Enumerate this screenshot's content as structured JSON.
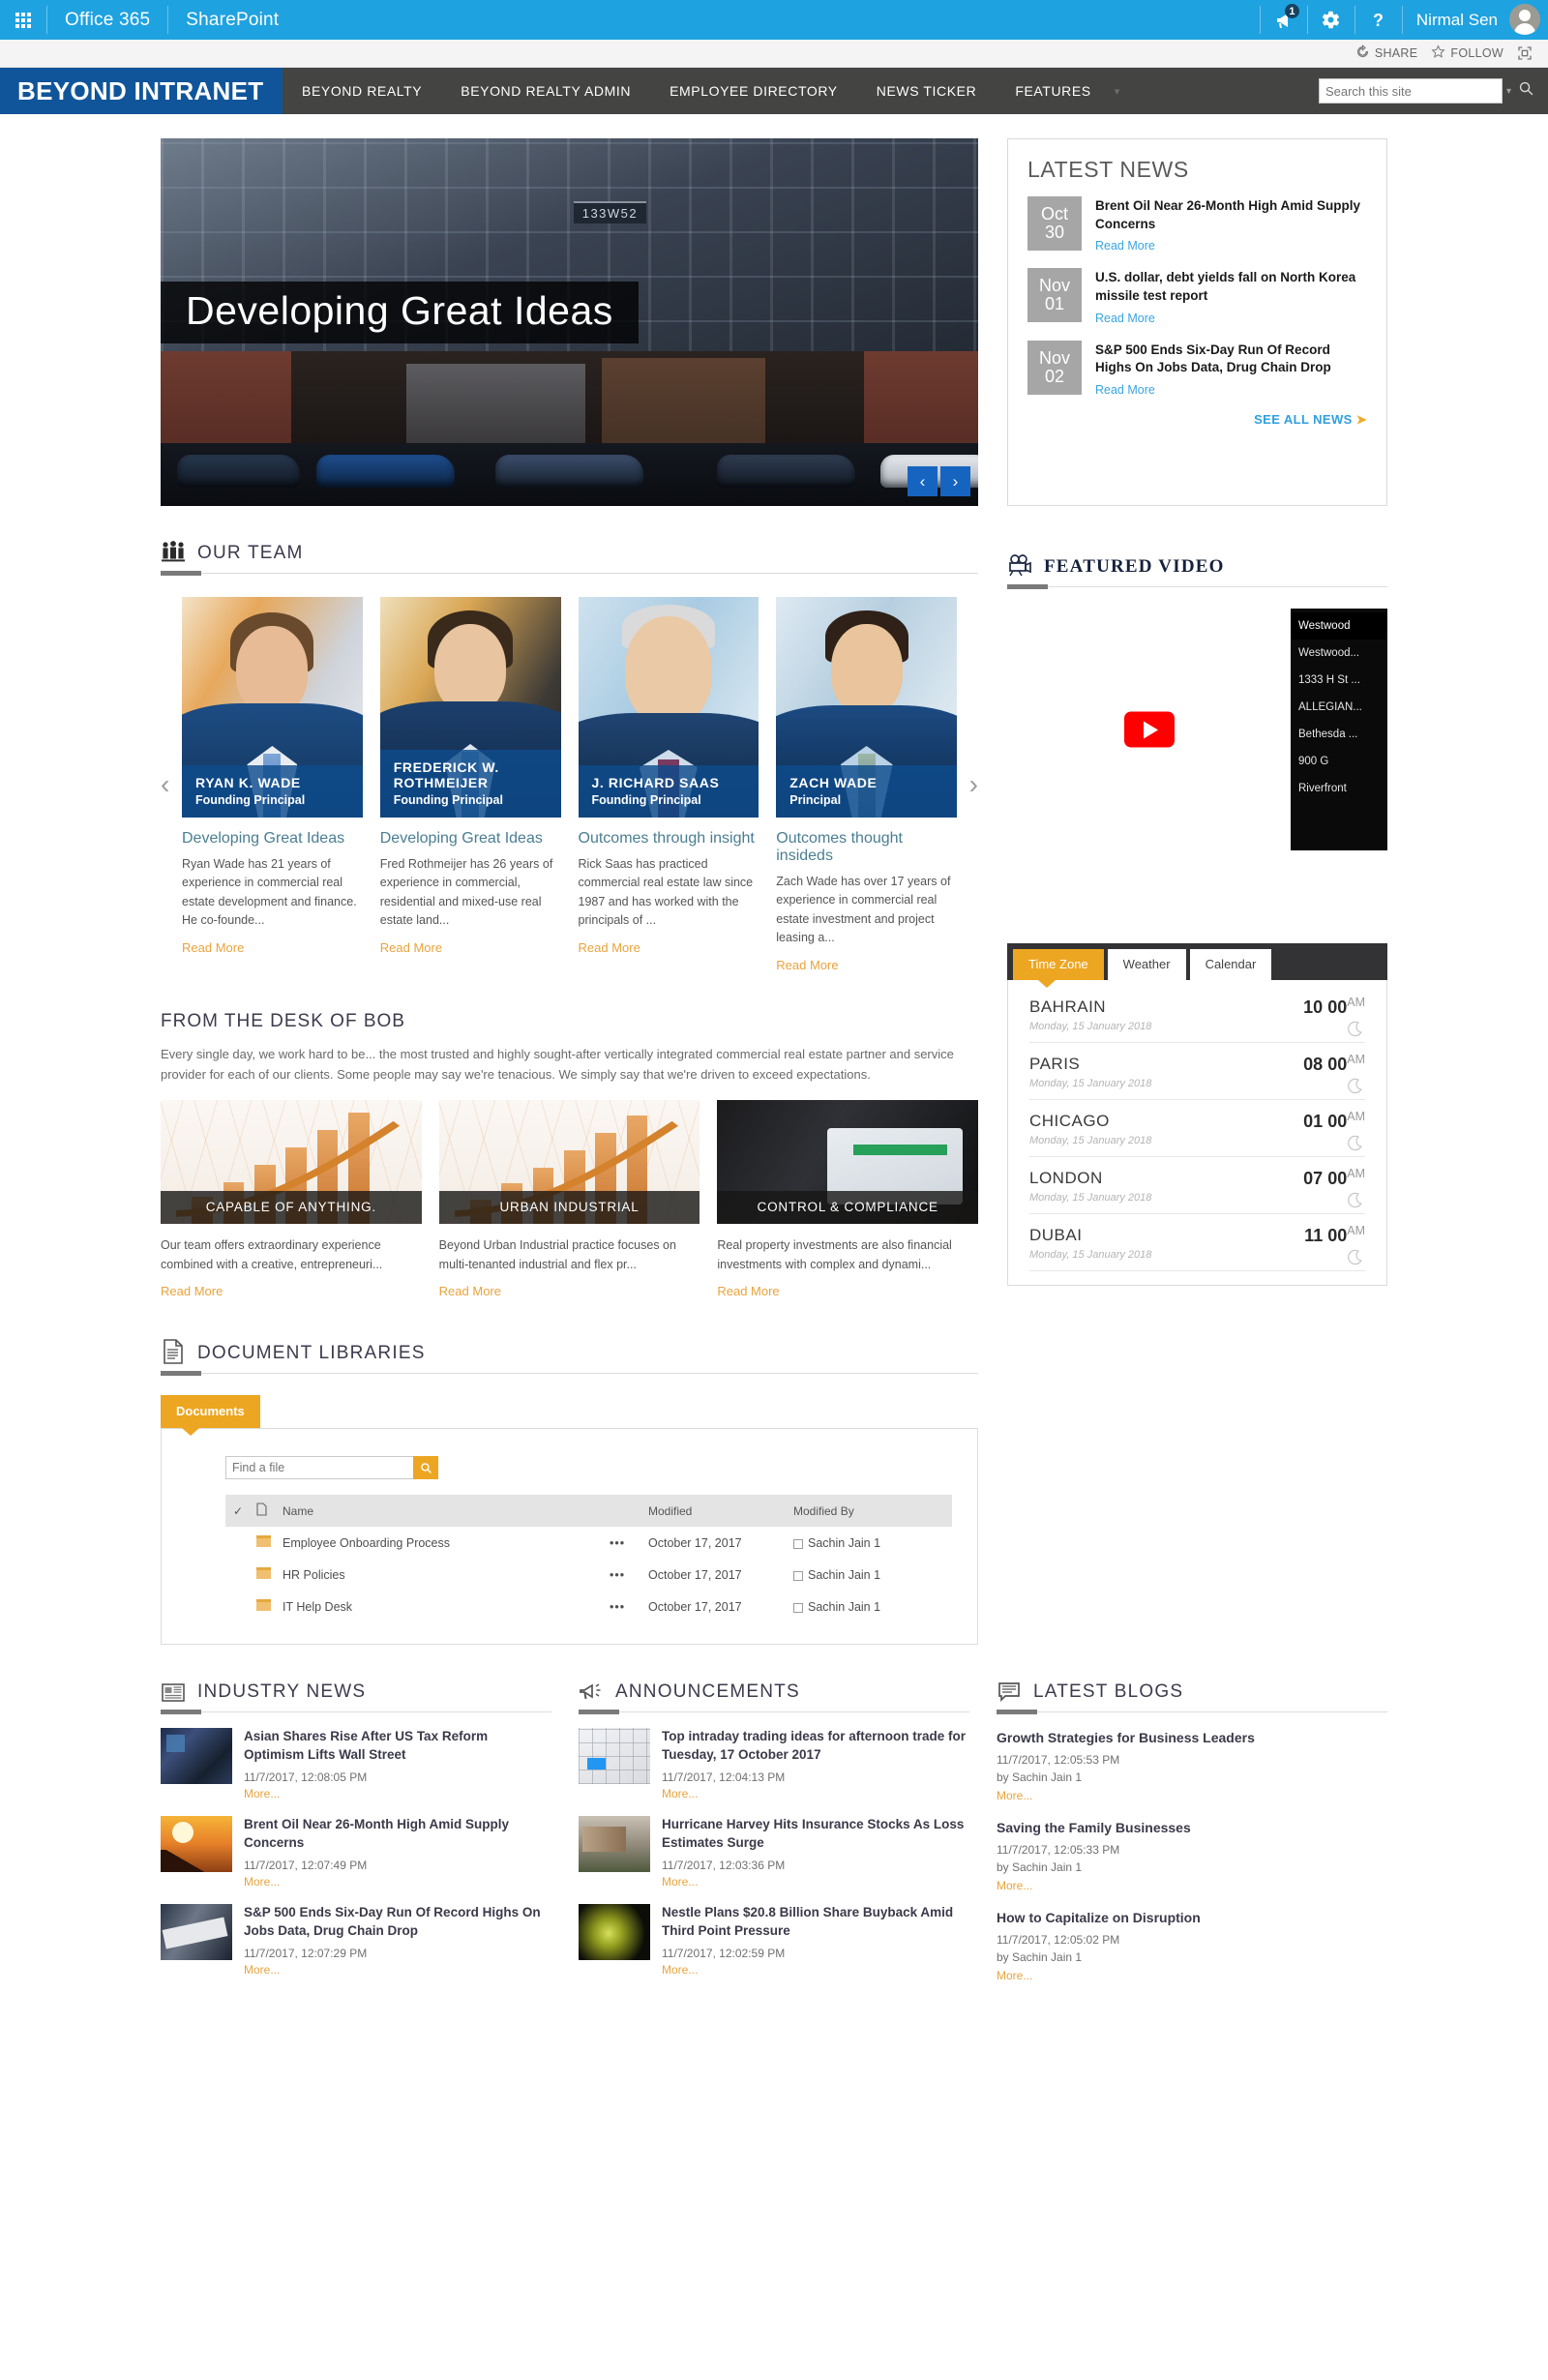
{
  "suite": {
    "waffle_icon": "app-launcher-icon",
    "office_label": "Office 365",
    "app_label": "SharePoint",
    "notification_icon": "megaphone-icon",
    "notification_count": "1",
    "settings_icon": "gear-icon",
    "help_icon": "question-mark-icon",
    "user_name": "Nirmal Sen",
    "avatar_icon": "user-avatar-icon",
    "accent_color": "#1fa2e0"
  },
  "share_row": {
    "share_icon": "share-icon",
    "share_label": "SHARE",
    "follow_icon": "star-icon",
    "follow_label": "FOLLOW",
    "focus_icon": "focus-on-content-icon"
  },
  "topnav": {
    "brand": "BEYOND INTRANET",
    "brand_color": "#10559a",
    "bar_color": "#444442",
    "links": [
      {
        "label": "BEYOND  REALTY"
      },
      {
        "label": "BEYOND  REALTY ADMIN"
      },
      {
        "label": "EMPLOYEE DIRECTORY"
      },
      {
        "label": "NEWS TICKER"
      },
      {
        "label": "FEATURES"
      }
    ],
    "caret_icon": "chevron-down-icon",
    "search_placeholder": "Search this site",
    "search_value": "",
    "search_caret_icon": "chevron-down-icon",
    "search_icon": "search-magnifier-icon"
  },
  "hero": {
    "caption": "Developing Great Ideas",
    "building_sign": "133W52",
    "prev_icon": "chevron-left-icon",
    "next_icon": "chevron-right-icon",
    "prev_label": "‹",
    "next_label": "›"
  },
  "latest_news": {
    "title": "LATEST NEWS",
    "items": [
      {
        "month": "Oct",
        "day": "30",
        "headline": "Brent Oil Near 26-Month High Amid Supply Concerns",
        "link": "Read More"
      },
      {
        "month": "Nov",
        "day": "01",
        "headline": "U.S. dollar, debt yields fall on North Korea missile test report",
        "link": "Read More"
      },
      {
        "month": "Nov",
        "day": "02",
        "headline": "S&P 500 Ends Six-Day Run Of Record Highs On Jobs Data, Drug Chain Drop",
        "link": "Read More"
      }
    ],
    "see_all": "SEE ALL NEWS",
    "see_all_arrow": "➤"
  },
  "our_team": {
    "icon": "people-group-icon",
    "title": "OUR TEAM",
    "prev_icon": "chevron-left-icon",
    "next_icon": "chevron-right-icon",
    "prev_label": "‹",
    "next_label": "›",
    "members": [
      {
        "name": "RYAN K. WADE",
        "role": "Founding Principal",
        "heading": "Developing Great Ideas",
        "excerpt": "Ryan Wade has 21 years of experience in commercial real estate development and finance. He co-founde...",
        "link": "Read More"
      },
      {
        "name": "FREDERICK W. ROTHMEIJER",
        "role": "Founding Principal",
        "heading": "Developing Great Ideas",
        "excerpt": "Fred Rothmeijer has 26 years of experience in commercial, residential and mixed-use real estate land...",
        "link": "Read More"
      },
      {
        "name": "J. RICHARD SAAS",
        "role": "Founding Principal",
        "heading": "Outcomes through insight",
        "excerpt": "Rick Saas has practiced commercial real estate law since 1987 and has worked with the principals of ...",
        "link": "Read More"
      },
      {
        "name": "ZACH WADE",
        "role": "Principal",
        "heading": "Outcomes thought insideds",
        "excerpt": "Zach Wade has over 17 years of experience in commercial real estate investment and project leasing a...",
        "link": "Read More"
      }
    ]
  },
  "desk_of_bob": {
    "title": "FROM THE DESK OF BOB",
    "paragraph": "Every single day, we work hard to be... the most trusted and highly sought-after vertically integrated commercial real estate partner and service provider for each of our clients. Some people may say we're tenacious. We simply say that we're driven to exceed expectations.",
    "cards": [
      {
        "label": "CAPABLE OF ANYTHING.",
        "excerpt": "Our team offers extraordinary experience combined with a creative, entrepreneuri...",
        "link": "Read More"
      },
      {
        "label": "URBAN INDUSTRIAL",
        "excerpt": "Beyond  Urban Industrial practice focuses on multi-tenanted industrial and flex pr...",
        "link": "Read More"
      },
      {
        "label": "CONTROL & COMPLIANCE",
        "excerpt": "Real property investments are also financial investments with complex and dynami...",
        "link": "Read More"
      }
    ]
  },
  "featured_video": {
    "icon": "movie-camera-icon",
    "title": "FEATURED VIDEO",
    "play_icon": "youtube-play-icon",
    "playlist": [
      {
        "label": "Westwood",
        "active": true
      },
      {
        "label": "Westwood..."
      },
      {
        "label": "1333 H St ..."
      },
      {
        "label": "ALLEGIAN..."
      },
      {
        "label": "Bethesda ..."
      },
      {
        "label": "900 G"
      },
      {
        "label": "Riverfront"
      }
    ]
  },
  "document_libraries": {
    "icon": "document-icon",
    "title": "DOCUMENT LIBRARIES",
    "tab_label": "Documents",
    "find_placeholder": "Find a file",
    "find_value": "",
    "find_icon": "search-magnifier-icon",
    "columns": [
      "",
      "",
      "Name",
      "",
      "Modified",
      "Modified By"
    ],
    "select_all_icon": "checkmark-icon",
    "type_icon": "file-type-icon",
    "rows": [
      {
        "name": "Employee Onboarding Process",
        "ellipsis": "•••",
        "modified": "October 17, 2017",
        "modified_by": "Sachin Jain 1"
      },
      {
        "name": "HR Policies",
        "ellipsis": "•••",
        "modified": "October 17, 2017",
        "modified_by": "Sachin Jain 1"
      },
      {
        "name": "IT Help Desk",
        "ellipsis": "•••",
        "modified": "October 17, 2017",
        "modified_by": "Sachin Jain 1"
      }
    ]
  },
  "info_widget": {
    "tabs": [
      {
        "label": "Time Zone",
        "active": true
      },
      {
        "label": "Weather",
        "active": false
      },
      {
        "label": "Calendar",
        "active": false
      }
    ],
    "accent_color": "#eda621",
    "moon_icon": "crescent-moon-icon",
    "zones": [
      {
        "city": "BAHRAIN",
        "hour": "10",
        "minute": "00",
        "ampm": "AM",
        "date": "Monday, 15 January 2018"
      },
      {
        "city": "PARIS",
        "hour": "08",
        "minute": "00",
        "ampm": "AM",
        "date": "Monday, 15 January 2018"
      },
      {
        "city": "CHICAGO",
        "hour": "01",
        "minute": "00",
        "ampm": "AM",
        "date": "Monday, 15 January 2018"
      },
      {
        "city": "LONDON",
        "hour": "07",
        "minute": "00",
        "ampm": "AM",
        "date": "Monday, 15 January 2018"
      },
      {
        "city": "DUBAI",
        "hour": "11",
        "minute": "00",
        "ampm": "AM",
        "date": "Monday, 15 January 2018"
      }
    ]
  },
  "industry_news": {
    "icon": "newspaper-icon",
    "title": "INDUSTRY NEWS",
    "items": [
      {
        "thumb": "trading-floor-thumb",
        "headline": "Asian Shares Rise After US Tax Reform Optimism Lifts Wall Street",
        "meta": "11/7/2017, 12:08:05 PM",
        "link": "More..."
      },
      {
        "thumb": "oil-pump-thumb",
        "headline": "Brent Oil Near 26-Month High Amid Supply Concerns",
        "meta": "11/7/2017, 12:07:49 PM",
        "link": "More..."
      },
      {
        "thumb": "wall-street-sign-thumb",
        "headline": "S&P 500 Ends Six-Day Run Of Record Highs On Jobs Data, Drug Chain Drop",
        "meta": "11/7/2017, 12:07:29 PM",
        "link": "More..."
      }
    ]
  },
  "announcements": {
    "icon": "megaphone-icon",
    "title": "ANNOUNCEMENTS",
    "items": [
      {
        "thumb": "keyboard-thumb",
        "headline": "Top intraday trading ideas for afternoon trade for Tuesday, 17 October 2017",
        "meta": "11/7/2017, 12:04:13 PM",
        "link": "More..."
      },
      {
        "thumb": "hurricane-damage-thumb",
        "headline": "Hurricane Harvey Hits Insurance Stocks As Loss Estimates Surge",
        "meta": "11/7/2017, 12:03:36 PM",
        "link": "More..."
      },
      {
        "thumb": "nestle-logo-thumb",
        "headline": "Nestle Plans $20.8 Billion Share Buyback Amid Third Point Pressure",
        "meta": "11/7/2017, 12:02:59 PM",
        "link": "More..."
      }
    ]
  },
  "latest_blogs": {
    "icon": "blog-icon",
    "title": "LATEST BLOGS",
    "items": [
      {
        "headline": "Growth Strategies for Business Leaders",
        "date": "11/7/2017, 12:05:53 PM",
        "author": "by Sachin Jain 1",
        "link": "More..."
      },
      {
        "headline": "Saving the Family Businesses",
        "date": "11/7/2017, 12:05:33 PM",
        "author": "by Sachin Jain 1",
        "link": "More..."
      },
      {
        "headline": "How to Capitalize on Disruption",
        "date": "11/7/2017, 12:05:02 PM",
        "author": "by Sachin Jain 1",
        "link": "More..."
      }
    ]
  }
}
